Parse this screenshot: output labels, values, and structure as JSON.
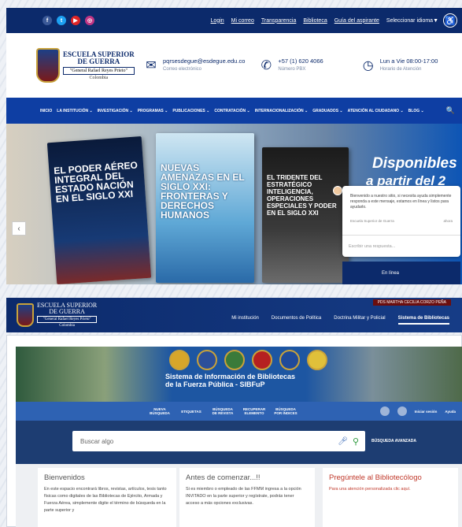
{
  "top_bar": {
    "social_icons": [
      "facebook-icon",
      "twitter-icon",
      "youtube-icon",
      "instagram-icon"
    ],
    "links": [
      "Login",
      "Mi correo",
      "Transparencia",
      "Biblioteca",
      "Guía del aspirante",
      "Seleccionar idioma▼"
    ],
    "accessibility_label": "♿"
  },
  "header": {
    "logo": {
      "line1": "ESCUELA SUPERIOR",
      "line2": "DE GUERRA",
      "motto": "\"General Rafael Reyes Prieto\"",
      "country": "Colombia"
    },
    "email": {
      "value": "pqrsesdegue@esdegue.edu.co",
      "label": "Correo electrónico"
    },
    "phone": {
      "value": "+57 (1) 620 4066",
      "label": "Número PBX"
    },
    "hours": {
      "value": "Lun a Vie 08:00-17:00",
      "label": "Horario de Atención"
    }
  },
  "main_nav": {
    "items": [
      "INICIO",
      "LA INSTITUCIÓN ⌄",
      "INVESTIGACIÓN ⌄",
      "PROGRAMAS ⌄",
      "PUBLICACIONES ⌄",
      "CONTRATACIÓN ⌄",
      "INTERNACIONALIZACIÓN ⌄",
      "GRADUADOS ⌄",
      "ATENCIÓN AL CIUDADANO ⌄",
      "BLOG ⌄"
    ],
    "search_icon": "🔍"
  },
  "banner": {
    "book1": "EL PODER AÉREO INTEGRAL DEL ESTADO NACIÓN EN EL SIGLO XXI",
    "book2": "NUEVAS AMENAZAS EN EL SIGLO XXI: FRONTERAS Y DERECHOS HUMANOS",
    "book3": "EL TRIDENTE DEL ESTRATÉGICO INTELIGENCIA, OPERACIONES ESPECIALES Y PODER EN EL SIGLO XXI",
    "headline1": "Disponibles",
    "headline2": "a partir del 2 de",
    "prev_arrow": "‹"
  },
  "chat": {
    "message": "Bienvenido a nuestro sitio, si necesita ayuda simplemente responda a este mensaje, estamos en línea y listos para ayudarlo.",
    "sender": "Escuela Superior de Guerra",
    "time": "ahora",
    "input_placeholder": "Escribir una respuesta...",
    "status": "En línea"
  },
  "sib_header": {
    "logo": {
      "line1": "ESCUELA SUPERIOR",
      "line2": "DE GUERRA",
      "motto": "\"General Rafael Reyes Prieto\"",
      "country": "Colombia"
    },
    "user": "PDS MARTHA CECILIA CORZO PEÑA",
    "nav": [
      "Mi institución",
      "Documentos de Política",
      "Doctrina Militar y Policial",
      "Sistema de Bibliotecas"
    ]
  },
  "sibfup": {
    "title1": "Sistema de Información de Bibliotecas",
    "title2": "de la Fuerza Pública - SIBFuP"
  },
  "tabs": {
    "items": [
      "NUEVA BÚSQUEDA",
      "ETIQUETAS",
      "BÚSQUEDA DE REVISTA",
      "RECUPERAR ELEMENTO",
      "BÚSQUEDA POR ÍNDICES"
    ],
    "login": "Iniciar sesión",
    "help": "Ayuda"
  },
  "search": {
    "placeholder": "Buscar algo",
    "advanced": "BÚSQUEDA AVANZADA"
  },
  "cards": {
    "welcome": {
      "title": "Bienvenidos",
      "text": "En este espacio encontrará libros, revistas, artículos, tesis tanto físicas como digitales de las Bibliotecas de Ejército, Armada y Fuerza Aérea, simplemente digite el término de búsqueda en la parte superior y"
    },
    "before": {
      "title": "Antes de comenzar...!!",
      "text": "Si es miembro o empleado de las FFMM ingresa a la opción INVITADO en la parte superior y regístrate, podrás tener acceso a más opciones exclusivas."
    },
    "ask": {
      "title": "Pregúntele al Bibliotecólogo",
      "text": "Para una atención personalizada clic aquí."
    }
  },
  "colors": {
    "navy": "#0c2a6b",
    "nav_blue": "#0e3ea3",
    "accent_red": "#c0392b"
  }
}
